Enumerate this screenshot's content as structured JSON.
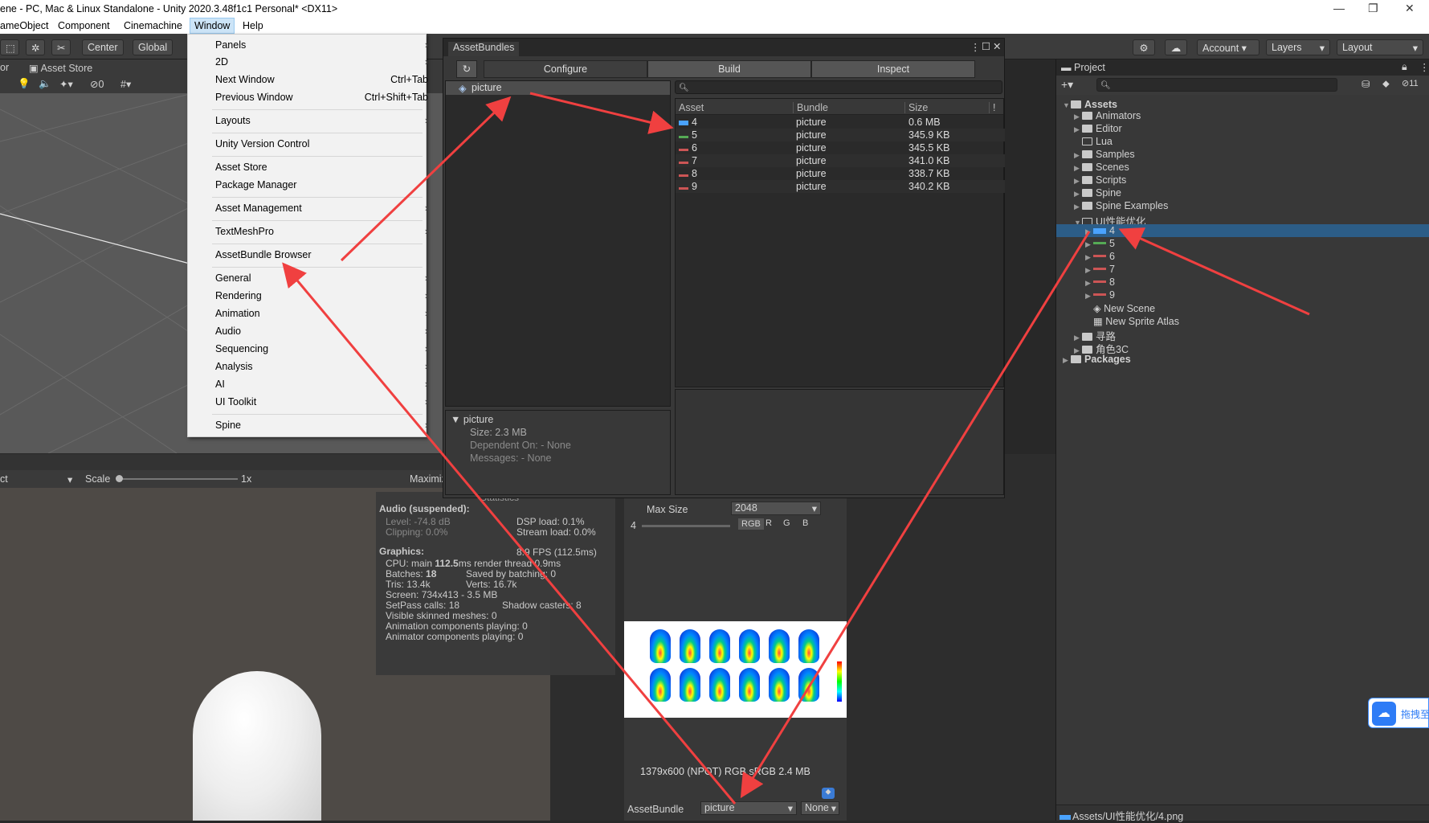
{
  "window": {
    "title": "ene - PC, Mac & Linux Standalone - Unity 2020.3.48f1c1 Personal* <DX11>",
    "minimize": "—",
    "maximize": "❐",
    "close": "✕"
  },
  "menubar": {
    "items": [
      "ameObject",
      "Component",
      "Cinemachine",
      "Window",
      "Help"
    ]
  },
  "toolbar": {
    "center": "Center",
    "global": "Global",
    "account": "Account",
    "layers": "Layers",
    "layout": "Layout",
    "unity_version_icon": "gear-icon"
  },
  "scene": {
    "tab_left": "or",
    "asset_store_tab": "Asset Store",
    "hidden_count": "0"
  },
  "game": {
    "display": "ct",
    "scale_label": "Scale",
    "scale_value": "1x",
    "maximize": "Maximiz"
  },
  "window_menu": {
    "panels": "Panels",
    "2d": "2D",
    "next_window": "Next Window",
    "next_window_sc": "Ctrl+Tab",
    "prev_window": "Previous Window",
    "prev_window_sc": "Ctrl+Shift+Tab",
    "layouts": "Layouts",
    "uvc": "Unity Version Control",
    "asset_store": "Asset Store",
    "package_manager": "Package Manager",
    "asset_management": "Asset Management",
    "textmeshpro": "TextMeshPro",
    "assetbundle_browser": "AssetBundle Browser",
    "general": "General",
    "rendering": "Rendering",
    "animation": "Animation",
    "audio": "Audio",
    "sequencing": "Sequencing",
    "analysis": "Analysis",
    "ai": "AI",
    "ui_toolkit": "UI Toolkit",
    "spine": "Spine",
    "arrow": "›"
  },
  "asset_bundles": {
    "title": "AssetBundles",
    "tabs": [
      "Configure",
      "Build",
      "Inspect"
    ],
    "bundle_item": "picture",
    "columns": [
      "Asset",
      "Bundle",
      "Size"
    ],
    "rows": [
      {
        "asset": "4",
        "bundle": "picture",
        "size": "0.6 MB"
      },
      {
        "asset": "5",
        "bundle": "picture",
        "size": "345.9 KB"
      },
      {
        "asset": "6",
        "bundle": "picture",
        "size": "345.5 KB"
      },
      {
        "asset": "7",
        "bundle": "picture",
        "size": "341.0 KB"
      },
      {
        "asset": "8",
        "bundle": "picture",
        "size": "338.7 KB"
      },
      {
        "asset": "9",
        "bundle": "picture",
        "size": "340.2 KB"
      }
    ],
    "detail": {
      "name": "picture",
      "size": "Size: 2.3 MB",
      "dependent": "Dependent On: - None",
      "messages": "Messages: - None"
    }
  },
  "stats": {
    "header": "Statistics",
    "audio_title": "Audio (suspended):",
    "level": "Level: -74.8 dB",
    "dsp": "DSP load: 0.1%",
    "clipping": "Clipping: 0.0%",
    "stream": "Stream load: 0.0%",
    "graphics_title": "Graphics:",
    "fps": "8.9 FPS (112.5ms)",
    "cpu_label": "CPU: main ",
    "cpu_value": "112.5",
    "cpu_rest": "ms  render thread 0.9ms",
    "batches_label": "Batches: ",
    "batches_value": "18",
    "saved": "Saved by batching: 0",
    "tris": "Tris: 13.4k",
    "verts": "Verts: 16.7k",
    "screen": "Screen: 734x413 - 3.5 MB",
    "setpass": "SetPass calls: 18",
    "shadow": "Shadow casters: 8",
    "skinned": "Visible skinned meshes: 0",
    "anim": "Animation components playing: 0",
    "animator": "Animator components playing: 0"
  },
  "inspector": {
    "max_size_label": "Max Size",
    "max_size_value": "2048",
    "mip": "4",
    "channels": [
      "RGB",
      "R",
      "G",
      "B"
    ],
    "preview_info": "1379x600 (NPOT)  RGB  sRGB   2.4 MB",
    "assetbundle_label": "AssetBundle",
    "assetbundle_value": "picture",
    "variant_value": "None"
  },
  "project": {
    "title": "Project",
    "search_count": "11",
    "tree": [
      {
        "label": "Assets",
        "bold": true
      },
      {
        "label": "Animators"
      },
      {
        "label": "Editor"
      },
      {
        "label": "Lua"
      },
      {
        "label": "Samples"
      },
      {
        "label": "Scenes"
      },
      {
        "label": "Scripts"
      },
      {
        "label": "Spine"
      },
      {
        "label": "Spine Examples"
      },
      {
        "label": "UI性能优化"
      },
      {
        "label": "4"
      },
      {
        "label": "5"
      },
      {
        "label": "6"
      },
      {
        "label": "7"
      },
      {
        "label": "8"
      },
      {
        "label": "9"
      },
      {
        "label": "New Scene"
      },
      {
        "label": "New Sprite Atlas"
      },
      {
        "label": "寻路"
      },
      {
        "label": "角色3C"
      },
      {
        "label": "Packages",
        "bold": true
      }
    ],
    "status_path": "Assets/UI性能优化/4.png"
  },
  "overlay": {
    "badge": "拖拽至"
  },
  "colors": {
    "accent_blue": "#2c5d87",
    "arrow_red": "#f04040",
    "selection": "#2c5d87"
  }
}
